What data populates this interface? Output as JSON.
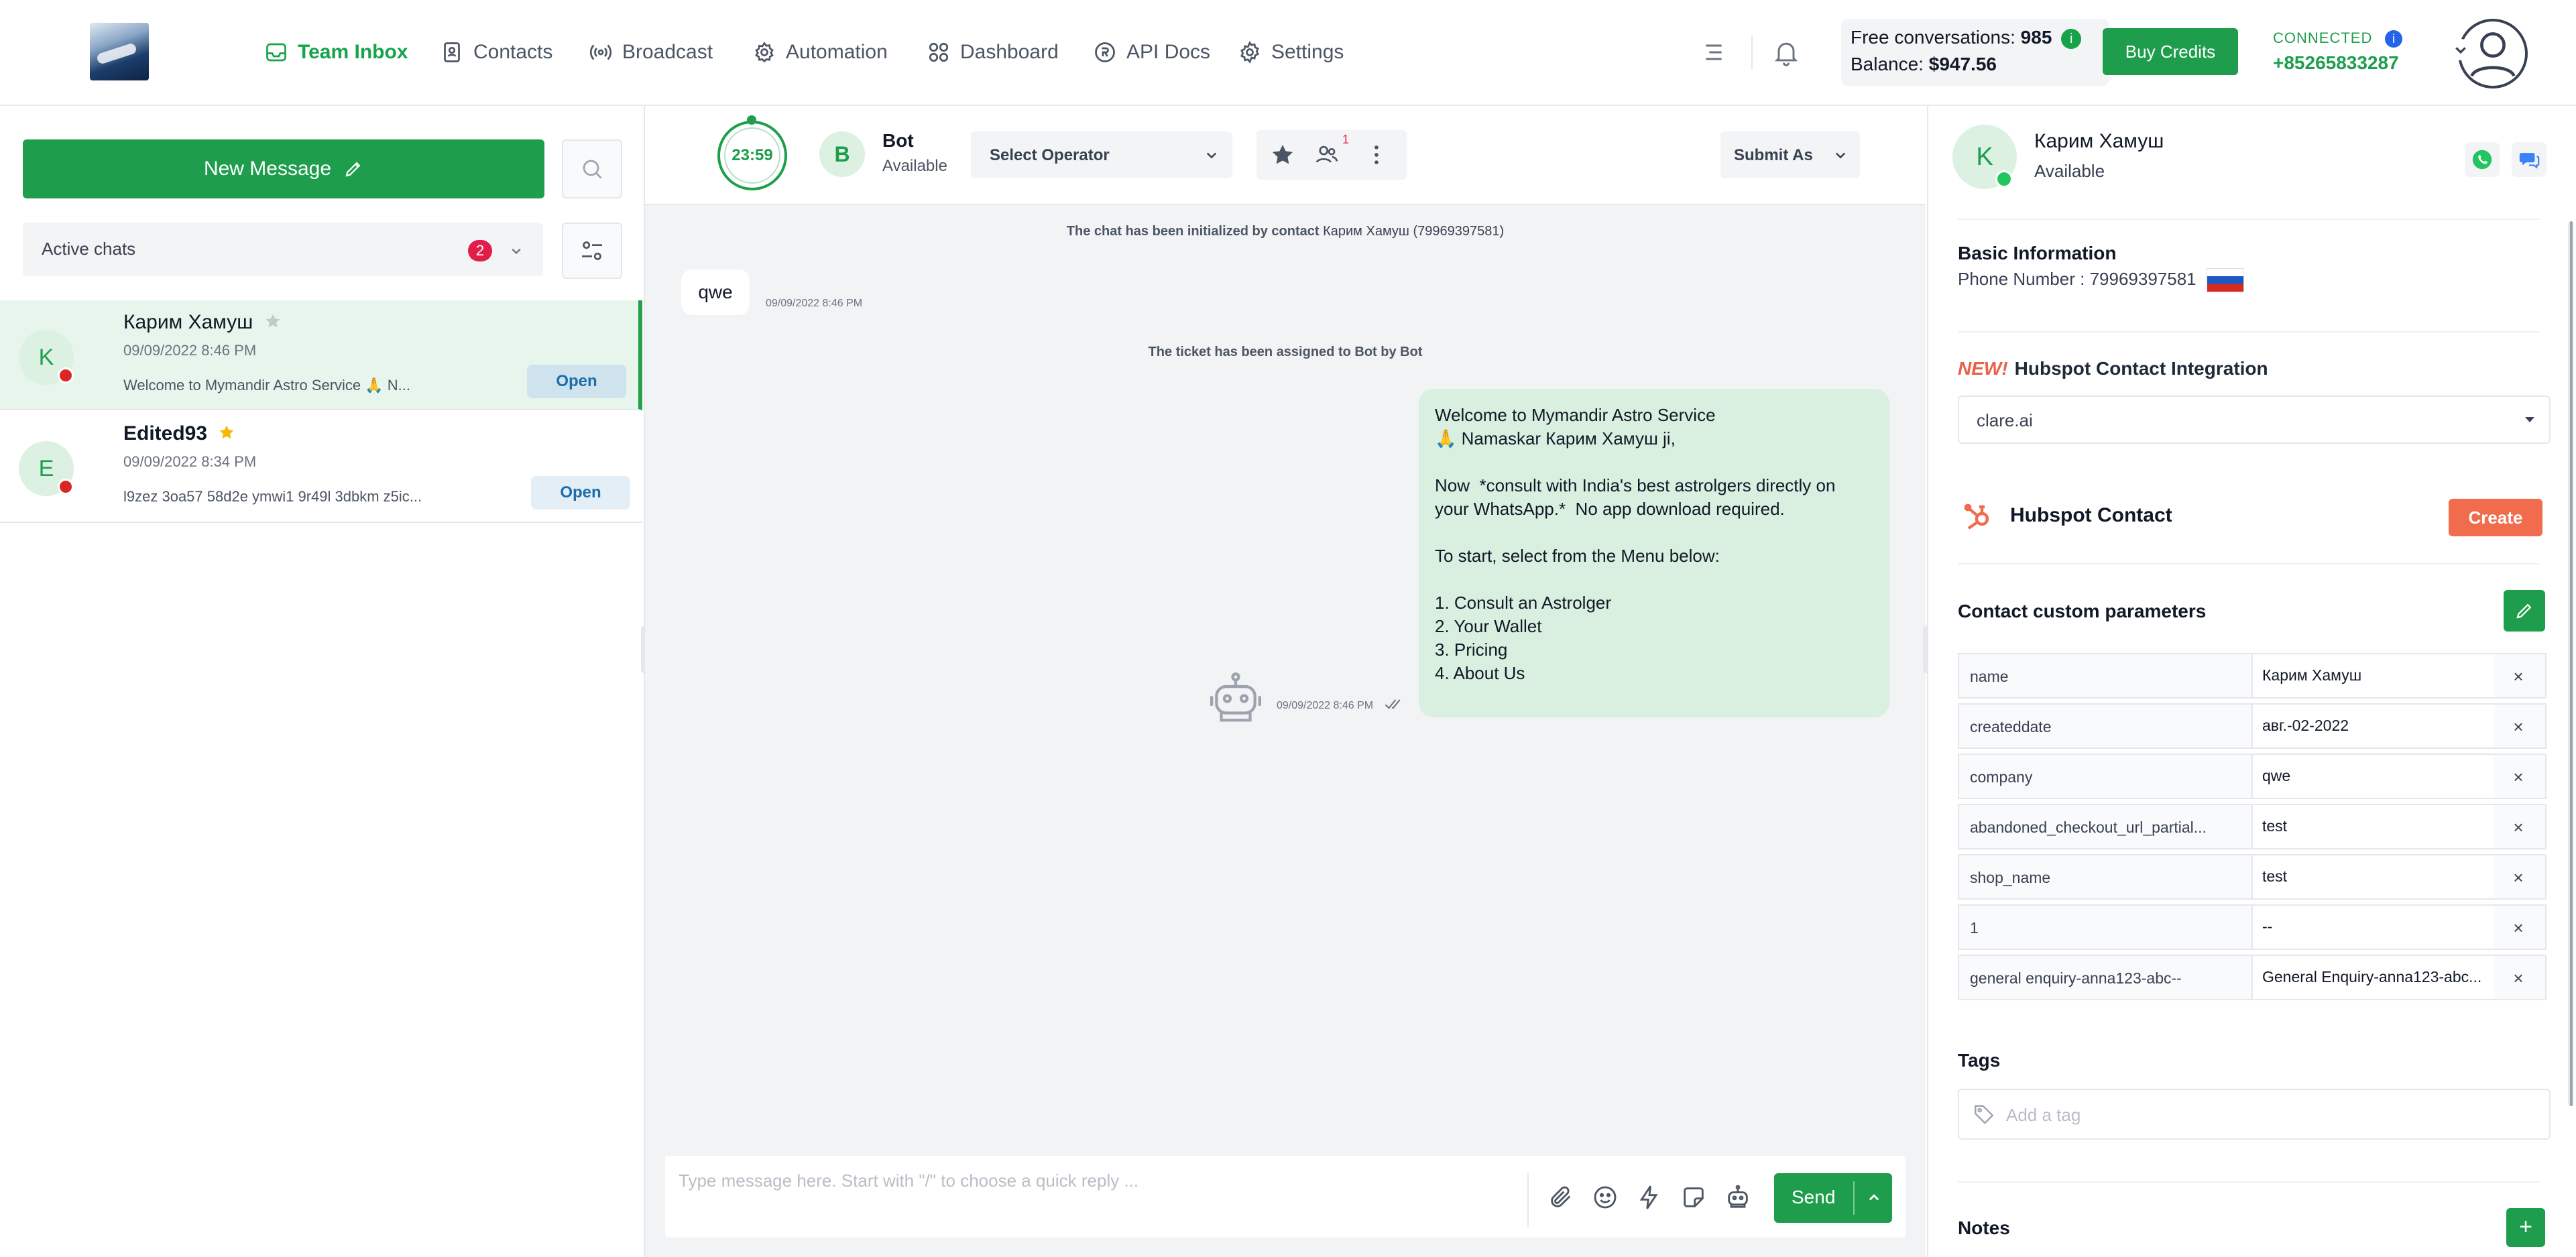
{
  "topbar": {
    "nav": [
      {
        "label": "Team Inbox",
        "icon": "inbox-icon",
        "active": true
      },
      {
        "label": "Contacts",
        "icon": "contacts-icon"
      },
      {
        "label": "Broadcast",
        "icon": "broadcast-icon"
      },
      {
        "label": "Automation",
        "icon": "automation-icon"
      },
      {
        "label": "Dashboard",
        "icon": "dashboard-icon"
      },
      {
        "label": "API Docs",
        "icon": "api-docs-icon"
      },
      {
        "label": "Settings",
        "icon": "settings-icon"
      }
    ],
    "free_conversations_label": "Free conversations:",
    "free_conversations_value": "985",
    "info_badge": "i",
    "balance_label": "Balance:",
    "balance_value": "$947.56",
    "buy_credits": "Buy Credits",
    "connection_status": "CONNECTED",
    "connection_badge": "i",
    "connected_phone": "+85265833287"
  },
  "left": {
    "new_message": "New Message",
    "filter_label": "Active chats",
    "filter_count": "2",
    "chats": [
      {
        "avatar": "K",
        "name": "Карим Хамуш",
        "starred": false,
        "date": "09/09/2022 8:46 PM",
        "preview": "Welcome to Mymandir Astro Service 🙏 N...",
        "action": "Open"
      },
      {
        "avatar": "E",
        "name": "Edited93",
        "starred": true,
        "date": "09/09/2022 8:34 PM",
        "preview": "l9zez 3oa57 58d2e ymwi1 9r49l 3dbkm z5ic...",
        "action": "Open"
      }
    ]
  },
  "chat": {
    "timer": "23:59",
    "bot_avatar": "B",
    "bot_name": "Bot",
    "bot_status": "Available",
    "select_operator": "Select Operator",
    "notification_count": "1",
    "submit_as": "Submit As",
    "system_init_prefix": "The chat has been initialized by contact",
    "system_init_contact": "Карим Хамуш (79969397581)",
    "incoming_text": "qwe",
    "incoming_time": "09/09/2022 8:46 PM",
    "system_assigned": "The ticket has been assigned to Bot by Bot",
    "outgoing_lines": [
      "Welcome to Mymandir Astro Service",
      "🙏 Namaskar Карим Хамуш ji,",
      "",
      "Now  *consult with India's best astrolgers directly on",
      "your WhatsApp.*  No app download required.",
      "",
      "To start, select from the Menu below:",
      "",
      "1. Consult an Astrolger",
      "2. Your Wallet",
      "3. Pricing",
      "4. About Us"
    ],
    "outgoing_time": "09/09/2022 8:46 PM",
    "composer_placeholder": "Type message here. Start with \"/\" to choose a quick reply ...",
    "send": "Send"
  },
  "contact": {
    "avatar": "K",
    "name": "Карим Хамуш",
    "status": "Available",
    "basic_info_title": "Basic Information",
    "phone_label": "Phone Number :",
    "phone_value": "79969397581",
    "hubspot_new": "NEW!",
    "hubspot_integration_title": "Hubspot Contact Integration",
    "hubspot_account": "clare.ai",
    "hubspot_contact_title": "Hubspot Contact",
    "create": "Create",
    "custom_params_title": "Contact custom parameters",
    "params": [
      {
        "key": "name",
        "value": "Карим Хамуш"
      },
      {
        "key": "createddate",
        "value": "авг.-02-2022"
      },
      {
        "key": "company",
        "value": "qwe"
      },
      {
        "key": "abandoned_checkout_url_partial...",
        "value": "test"
      },
      {
        "key": "shop_name",
        "value": "test"
      },
      {
        "key": "1",
        "value": "--"
      },
      {
        "key": "general enquiry-anna123-abc--",
        "value": "General Enquiry-anna123-abc..."
      }
    ],
    "remove_symbol": "×",
    "tags_title": "Tags",
    "tag_placeholder": "Add a tag",
    "notes_title": "Notes",
    "add_symbol": "+"
  },
  "colors": {
    "brand_green": "#1e9e4c",
    "badge_red": "#e11d48",
    "hubspot_orange": "#f06c4c",
    "chat_bubble": "#d9efe0"
  }
}
